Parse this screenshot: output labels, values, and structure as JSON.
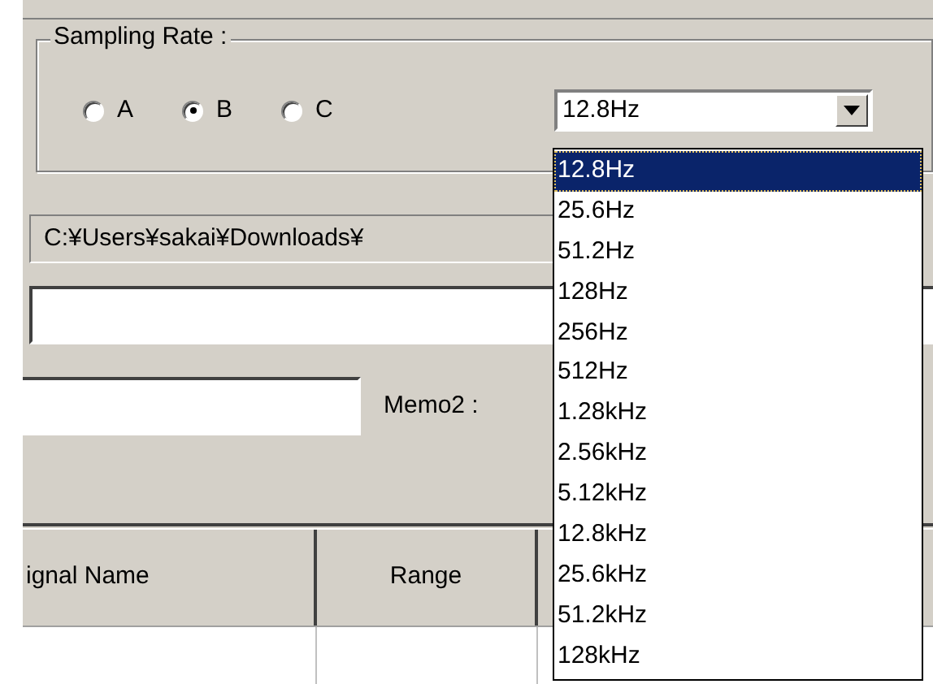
{
  "sampling_rate": {
    "label": "Sampling Rate :",
    "options": [
      {
        "label": "A",
        "selected": false
      },
      {
        "label": "B",
        "selected": true
      },
      {
        "label": "C",
        "selected": false
      }
    ],
    "dropdown": {
      "value": "12.8Hz",
      "expanded": true,
      "items": [
        {
          "label": "12.8Hz",
          "selected": true
        },
        {
          "label": "25.6Hz",
          "selected": false
        },
        {
          "label": "51.2Hz",
          "selected": false
        },
        {
          "label": "128Hz",
          "selected": false
        },
        {
          "label": "256Hz",
          "selected": false
        },
        {
          "label": "512Hz",
          "selected": false
        },
        {
          "label": "1.28kHz",
          "selected": false
        },
        {
          "label": "2.56kHz",
          "selected": false
        },
        {
          "label": "5.12kHz",
          "selected": false
        },
        {
          "label": "12.8kHz",
          "selected": false
        },
        {
          "label": "25.6kHz",
          "selected": false
        },
        {
          "label": "51.2kHz",
          "selected": false
        },
        {
          "label": "128kHz",
          "selected": false
        }
      ]
    }
  },
  "path_field": {
    "value": "C:¥Users¥sakai¥Downloads¥"
  },
  "memo2": {
    "label": "Memo2 :"
  },
  "table": {
    "columns": [
      "ignal Name",
      "Range"
    ]
  }
}
